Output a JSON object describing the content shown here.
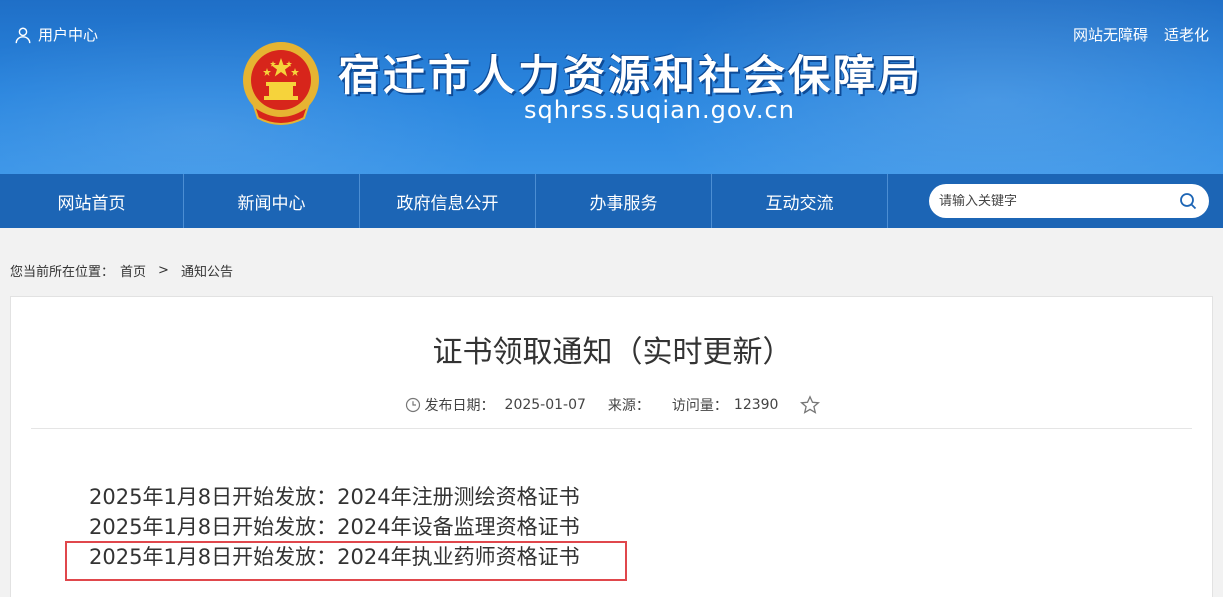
{
  "header": {
    "user_center": "用户中心",
    "accessibility": "网站无障碍",
    "elderly": "适老化",
    "site_title": "宿迁市人力资源和社会保障局",
    "site_domain": "sqhrss.suqian.gov.cn"
  },
  "nav": {
    "items": [
      "网站首页",
      "新闻中心",
      "政府信息公开",
      "办事服务",
      "互动交流"
    ],
    "search_placeholder": "请输入关键字"
  },
  "breadcrumb": {
    "prefix": "您当前所在位置：",
    "home": "首页",
    "separator": ">",
    "current": "通知公告"
  },
  "article": {
    "title": "证书领取通知（实时更新）",
    "date_label": "发布日期：",
    "date": "2025-01-07",
    "source_label": "来源：",
    "views_label": "访问量：",
    "views": "12390",
    "notices": [
      "2025年1月8日开始发放：2024年注册测绘资格证书",
      "2025年1月8日开始发放：2024年设备监理资格证书",
      "2025年1月8日开始发放：2024年执业药师资格证书"
    ]
  },
  "colors": {
    "header_blue": "#2a86df",
    "nav_blue": "#1c65b5",
    "highlight_red": "#e0474c"
  }
}
